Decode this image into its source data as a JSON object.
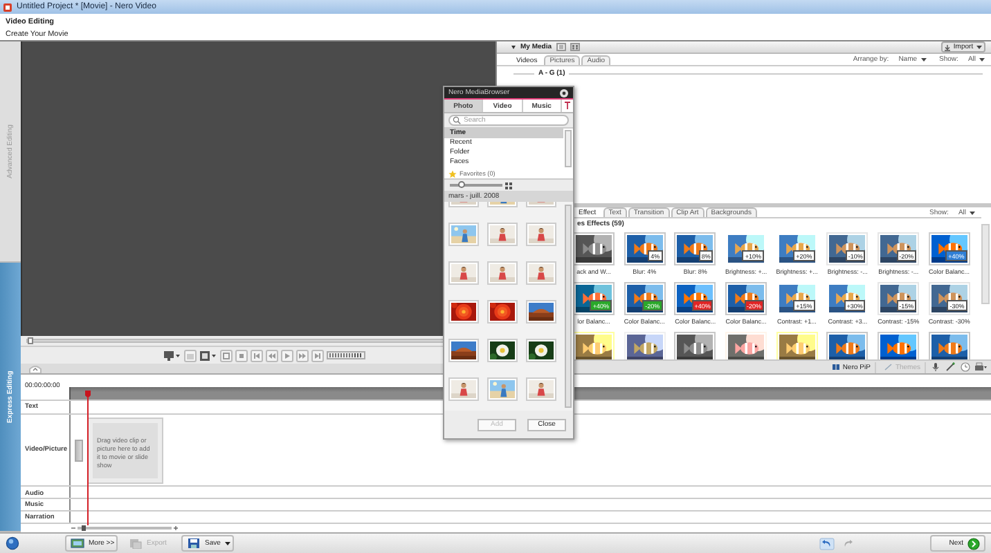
{
  "window": {
    "title": "Untitled Project * [Movie] - Nero Video"
  },
  "header": {
    "title": "Video Editing",
    "subtitle": "Create Your Movie"
  },
  "side_tabs": [
    {
      "label": "Advanced Editing",
      "selected": false
    },
    {
      "label": "Express Editing",
      "selected": true
    }
  ],
  "preview": {
    "level": 0
  },
  "my_media": {
    "title": "My Media",
    "import": "Import",
    "tabs": [
      {
        "label": "Videos",
        "selected": true
      },
      {
        "label": "Pictures",
        "selected": false
      },
      {
        "label": "Audio",
        "selected": false
      }
    ],
    "arrange_label": "Arrange by:",
    "arrange_value": "Name",
    "show_label": "Show:",
    "show_value": "All",
    "group": "A - G (1)"
  },
  "effects": {
    "tabs": [
      {
        "label": "Effect",
        "selected": true
      },
      {
        "label": "Text",
        "selected": false
      },
      {
        "label": "Transition",
        "selected": false
      },
      {
        "label": "Clip Art",
        "selected": false
      },
      {
        "label": "Backgrounds",
        "selected": false
      }
    ],
    "show_label": "Show:",
    "show_value": "All",
    "heading": "es Effects (59)",
    "items": [
      {
        "kind": "effect",
        "label": "ack and W..."
      },
      {
        "kind": "effect",
        "label": "Blur: 4%",
        "badge": "4%",
        "color": "#ffffff"
      },
      {
        "kind": "effect",
        "label": "Blur: 8%",
        "badge": "8%",
        "color": "#ffffff"
      },
      {
        "kind": "effect",
        "label": "Brightness: +...",
        "badge": "+10%",
        "color": "#ffffff"
      },
      {
        "kind": "effect",
        "label": "Brightness: +...",
        "badge": "+20%",
        "color": "#ffffff"
      },
      {
        "kind": "effect",
        "label": "Brightness: -...",
        "badge": "-10%",
        "color": "#ffffff"
      },
      {
        "kind": "effect",
        "label": "Brightness: -...",
        "badge": "-20%",
        "color": "#ffffff"
      },
      {
        "kind": "effect",
        "label": "Color Balanc...",
        "badge": "+40%",
        "color": "#2f7fd6"
      },
      {
        "kind": "effect",
        "label": "lor Balanc...",
        "badge": "+40%",
        "color": "#2aa82a"
      },
      {
        "kind": "effect",
        "label": "Color Balanc...",
        "badge": "-20%",
        "color": "#2aa82a"
      },
      {
        "kind": "effect",
        "label": "Color Balanc...",
        "badge": "+40%",
        "color": "#e02424"
      },
      {
        "kind": "effect",
        "label": "Color Balanc...",
        "badge": "-20%",
        "color": "#e02424"
      },
      {
        "kind": "effect",
        "label": "Contrast: +1...",
        "badge": "+15%",
        "color": "#ffffff"
      },
      {
        "kind": "effect",
        "label": "Contrast: +3...",
        "badge": "+30%",
        "color": "#ffffff"
      },
      {
        "kind": "effect",
        "label": "Contrast: -15%",
        "badge": "-15%",
        "color": "#ffffff"
      },
      {
        "kind": "effect",
        "label": "Contrast: -30%",
        "badge": "-30%",
        "color": "#ffffff"
      },
      {
        "kind": "thumbnail"
      },
      {
        "kind": "thumbnail"
      },
      {
        "kind": "thumbnail"
      },
      {
        "kind": "thumbnail"
      },
      {
        "kind": "thumbnail"
      },
      {
        "kind": "thumbnail"
      },
      {
        "kind": "thumbnail"
      },
      {
        "kind": "thumbnail"
      }
    ]
  },
  "effects_toolbar": {
    "buttons": [
      {
        "label": "Nero PiP",
        "disabled": false
      },
      {
        "label": "Themes",
        "disabled": true
      }
    ]
  },
  "timeline": {
    "timecode": "00:00:00:00",
    "tracks": [
      {
        "kind": "text",
        "label": "Text"
      },
      {
        "kind": "video",
        "label": "Video/Picture",
        "hint": "Drag video clip or picture here to add it to movie or slide show"
      },
      {
        "kind": "audio",
        "label": "Audio"
      },
      {
        "kind": "music",
        "label": "Music"
      },
      {
        "kind": "narration",
        "label": "Narration"
      }
    ],
    "zoom": {
      "level": 0.05
    }
  },
  "media_browser": {
    "title": "Nero MediaBrowser",
    "tabs": [
      {
        "label": "Photo",
        "selected": true
      },
      {
        "label": "Video",
        "selected": false
      },
      {
        "label": "Music",
        "selected": false
      }
    ],
    "search_placeholder": "Search",
    "categories": [
      {
        "kind": "item",
        "label": "Time",
        "selected": true
      },
      {
        "kind": "item",
        "label": "Recent",
        "selected": false
      },
      {
        "kind": "item",
        "label": "Folder",
        "selected": false
      },
      {
        "kind": "item",
        "label": "Faces",
        "selected": false
      },
      {
        "kind": "favorites",
        "label": "Favorites (0)",
        "selected": false
      }
    ],
    "size": {
      "level": 0.15
    },
    "group": "mars - juill. 2008",
    "buttons": [
      {
        "label": "Add",
        "disabled": true
      },
      {
        "label": "Close",
        "disabled": false
      }
    ]
  },
  "bottom_bar": {
    "buttons": [
      {
        "label": "More >>",
        "disabled": false
      },
      {
        "label": "Export",
        "disabled": true
      },
      {
        "label": "Save",
        "disabled": false
      }
    ],
    "next": "Next"
  }
}
